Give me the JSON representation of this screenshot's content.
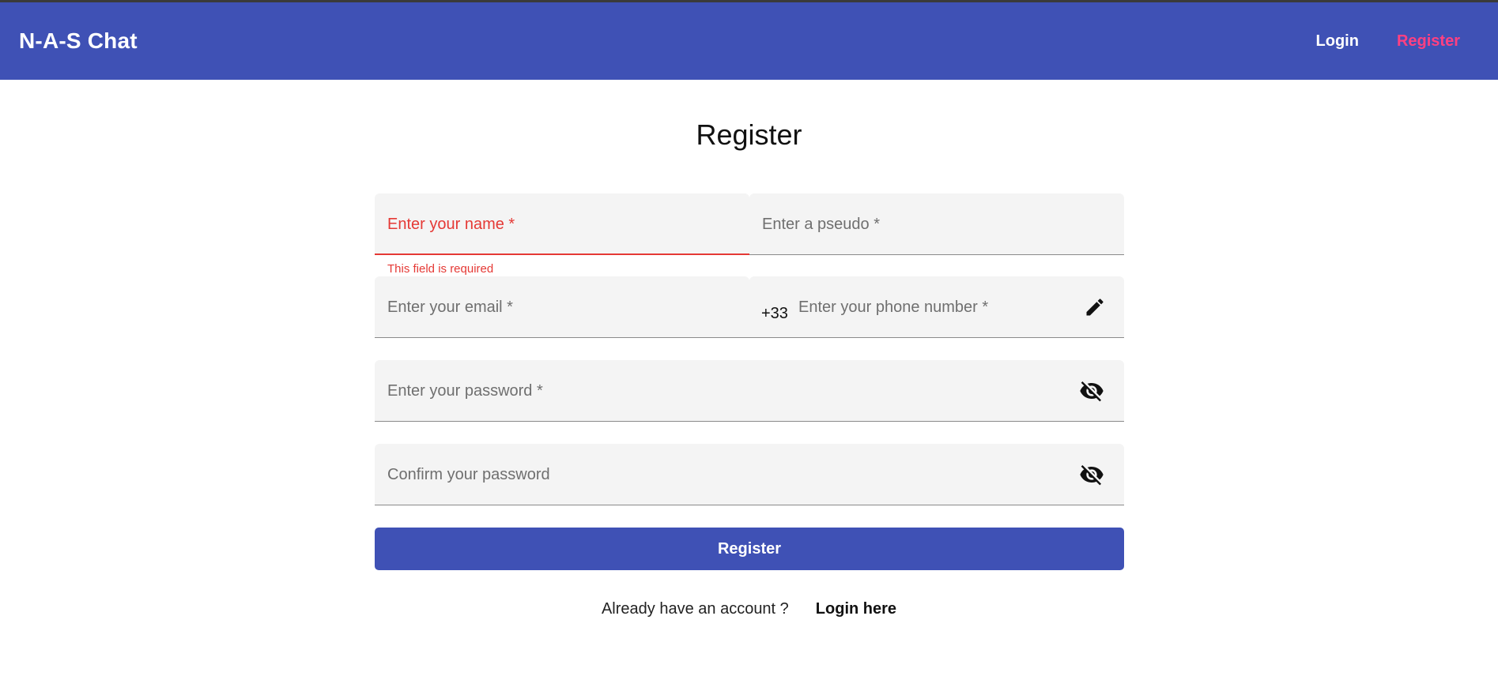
{
  "header": {
    "brand": "N-A-S Chat",
    "nav": {
      "login": "Login",
      "register": "Register"
    }
  },
  "page": {
    "title": "Register"
  },
  "form": {
    "name": {
      "placeholder": "Enter your name *",
      "error": "This field is required"
    },
    "pseudo": {
      "placeholder": "Enter a pseudo *"
    },
    "email": {
      "placeholder": "Enter your email *"
    },
    "phone": {
      "prefix": "+33",
      "placeholder": "Enter your phone number *",
      "icon": "edit-icon"
    },
    "password": {
      "placeholder": "Enter your password *",
      "icon": "visibility-off-icon"
    },
    "confirm": {
      "placeholder": "Confirm your password",
      "icon": "visibility-off-icon"
    },
    "submit_label": "Register"
  },
  "footer": {
    "question": "Already have an account ?",
    "login_link": "Login here"
  },
  "colors": {
    "primary": "#3f51b5",
    "accent": "#ff4081",
    "error": "#e53935"
  }
}
